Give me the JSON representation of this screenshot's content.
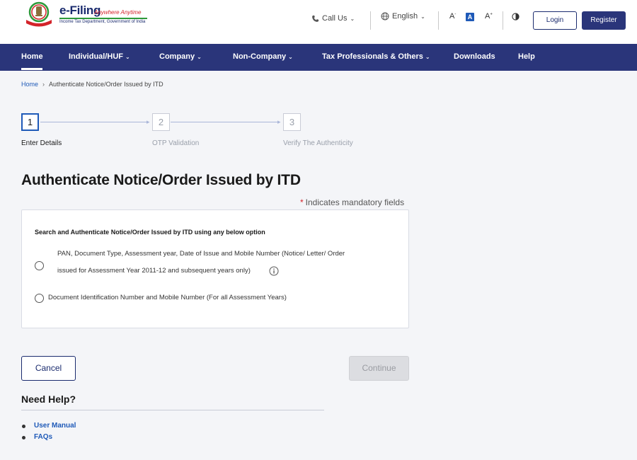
{
  "header": {
    "logo_title": "e-Filing",
    "logo_tagline": "Anywhere Anytime",
    "logo_subtitle": "Income Tax Department, Government of India",
    "call_us": "Call Us",
    "language": "English",
    "font_decrease": "A",
    "font_default": "A",
    "font_increase": "A",
    "login_label": "Login",
    "register_label": "Register"
  },
  "nav": {
    "items": [
      {
        "label": "Home"
      },
      {
        "label": "Individual/HUF"
      },
      {
        "label": "Company"
      },
      {
        "label": "Non-Company"
      },
      {
        "label": "Tax Professionals & Others"
      },
      {
        "label": "Downloads"
      },
      {
        "label": "Help"
      }
    ]
  },
  "breadcrumb": {
    "home": "Home",
    "current": "Authenticate Notice/Order Issued by ITD"
  },
  "stepper": {
    "steps": [
      {
        "number": "1",
        "label": "Enter Details"
      },
      {
        "number": "2",
        "label": "OTP Validation"
      },
      {
        "number": "3",
        "label": "Verify The Authenticity"
      }
    ]
  },
  "page": {
    "title": "Authenticate Notice/Order Issued by ITD",
    "mandatory_note": "Indicates mandatory fields",
    "mandatory_star": "*"
  },
  "form": {
    "heading": "Search and Authenticate Notice/Order Issued by ITD using any below option",
    "option1_line1": "PAN, Document Type, Assessment year, Date of Issue and Mobile Number (Notice/ Letter/ Order",
    "option1_line2": "issued for Assessment Year 2011-12 and subsequent years only)",
    "option2": "Document Identification Number and Mobile Number (For all Assessment Years)"
  },
  "actions": {
    "cancel_label": "Cancel",
    "continue_label": "Continue"
  },
  "help": {
    "title": "Need Help?",
    "links": [
      {
        "label": "User Manual"
      },
      {
        "label": "FAQs"
      }
    ]
  },
  "colors": {
    "nav_bg": "#2a357a",
    "accent_blue": "#1f5ab8",
    "brand_red": "#d3232a"
  }
}
